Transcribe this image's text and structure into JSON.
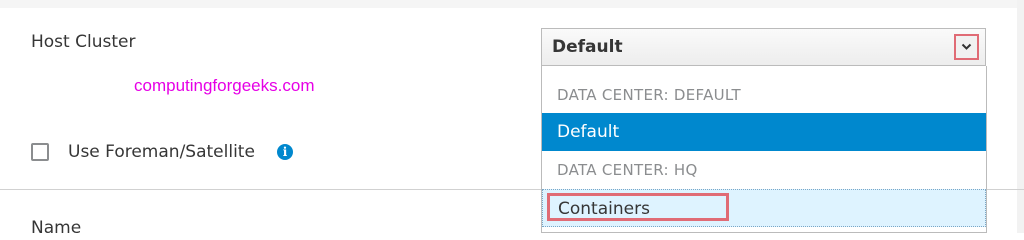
{
  "form": {
    "host_cluster_label": "Host Cluster",
    "use_foreman_label": "Use Foreman/Satellite",
    "name_label": "Name",
    "watermark": "computingforgeeks.com"
  },
  "select": {
    "value": "Default",
    "caret_icon": "chevron-down-icon",
    "options": [
      {
        "kind": "header",
        "label": "DATA CENTER: DEFAULT"
      },
      {
        "kind": "option",
        "label": "Default",
        "selected": true
      },
      {
        "kind": "header",
        "label": "DATA CENTER: HQ"
      },
      {
        "kind": "option",
        "label": "Containers",
        "hovered": true,
        "annotated": true
      }
    ]
  },
  "colors": {
    "accent_blue": "#0088ce",
    "hover_blue": "#def3ff",
    "annotation_red": "#e06b75",
    "watermark_magenta": "#e600e6"
  }
}
